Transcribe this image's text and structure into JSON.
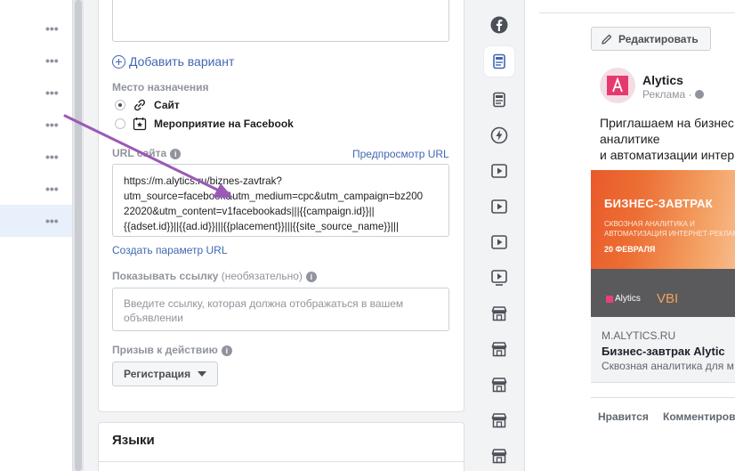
{
  "left_list": {
    "rows": [
      {
        "dots": "•••",
        "active": false
      },
      {
        "dots": "•••",
        "active": false
      },
      {
        "dots": "•••",
        "active": false
      },
      {
        "dots": "•••",
        "active": false
      },
      {
        "dots": "•••",
        "active": false
      },
      {
        "dots": "•••",
        "active": false
      },
      {
        "dots": "•••",
        "active": true
      }
    ]
  },
  "form": {
    "add_variant_label": "Добавить вариант",
    "destination_label": "Место назначения",
    "destination_options": [
      {
        "label": "Сайт",
        "selected": true,
        "icon": "link-icon"
      },
      {
        "label": "Мероприятие на Facebook",
        "selected": false,
        "icon": "event-star-icon"
      }
    ],
    "url_label": "URL сайта",
    "url_preview_link": "Предпросмотр URL",
    "url_value": "https://m.alytics.ru/biznes-zavtrak?\nutm_source=facebook&utm_medium=cpc&utm_campaign=bz200\n22020&utm_content=v1facebookads|||{{campaign.id}}||\n{{adset.id}}||{{ad.id}}|||{{placement}}|||{{site_source_name}}|||",
    "url_param_link": "Создать параметр URL",
    "display_link_label": "Показывать ссылку",
    "display_link_optional": "(необязательно)",
    "display_link_placeholder": "Введите ссылку, которая должна отображаться в вашем объявлении",
    "cta_label": "Призыв к действию",
    "cta_value": "Регистрация",
    "languages_title": "Языки"
  },
  "icon_column": [
    {
      "icon": "facebook-icon",
      "active": false
    },
    {
      "icon": "feed-icon",
      "active": true
    },
    {
      "icon": "feed-alt-icon",
      "active": false
    },
    {
      "icon": "instant-articles-icon",
      "active": false
    },
    {
      "icon": "video-icon",
      "active": false
    },
    {
      "icon": "video-icon",
      "active": false
    },
    {
      "icon": "video-icon",
      "active": false
    },
    {
      "icon": "video-feed-icon",
      "active": false
    },
    {
      "icon": "marketplace-icon",
      "active": false
    },
    {
      "icon": "marketplace-icon",
      "active": false
    },
    {
      "icon": "marketplace-icon",
      "active": false
    },
    {
      "icon": "marketplace-icon",
      "active": false
    },
    {
      "icon": "marketplace-icon",
      "active": false
    }
  ],
  "preview": {
    "edit_button": "Редактировать",
    "page_name": "Alytics",
    "sponsored": "Реклама ·",
    "ad_text": "Приглашаем на бизнес\nаналитике\nи автоматизации интер",
    "image": {
      "title": "БИЗНЕС-ЗАВТРАК",
      "subtitle": "СКВОЗНАЯ АНАЛИТИКА И\nАВТОМАТИЗАЦИЯ ИНТЕРНЕТ-РЕКЛАМ",
      "date": "20 ФЕВРАЛЯ",
      "logo1": "Alytics",
      "logo2": "VBI"
    },
    "link_domain": "M.ALYTICS.RU",
    "link_title": "Бизнес-завтрак Alytic",
    "link_desc": "Сквозная аналитика для м",
    "like_label": "Нравится",
    "comment_label": "Комментиров"
  },
  "colors": {
    "accent": "#4267b2",
    "arrow": "#9b59b6"
  }
}
